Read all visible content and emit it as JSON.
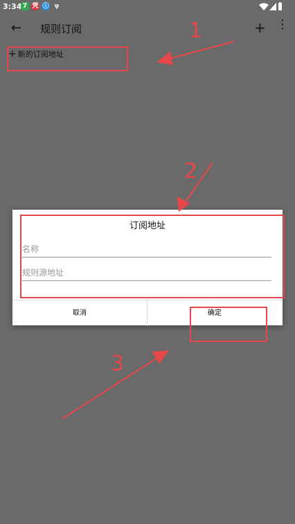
{
  "status_bar": {
    "time": "3:34",
    "badges": [
      {
        "text": "7",
        "color": "#3aa655"
      },
      {
        "text": "凭",
        "color": "#d9333f"
      },
      {
        "text": "ⓘ",
        "color": "#2a8be0"
      },
      {
        "text": "ψ",
        "color": "#bbbbbb"
      }
    ],
    "icons": [
      "wifi-icon",
      "signal-icon",
      "battery-icon"
    ]
  },
  "toolbar": {
    "back_icon": "←",
    "title": "规则订阅",
    "add_icon": "+",
    "more_icon": "⋮"
  },
  "list": {
    "add_icon": "+",
    "new_label": "新的订阅地址"
  },
  "dialog": {
    "title": "订阅地址",
    "name_placeholder": "名称",
    "url_placeholder": "规则源地址",
    "cancel_label": "取消",
    "ok_label": "确定"
  },
  "annotations": {
    "color": "#e8474a",
    "labels": [
      "1",
      "2",
      "3"
    ]
  }
}
